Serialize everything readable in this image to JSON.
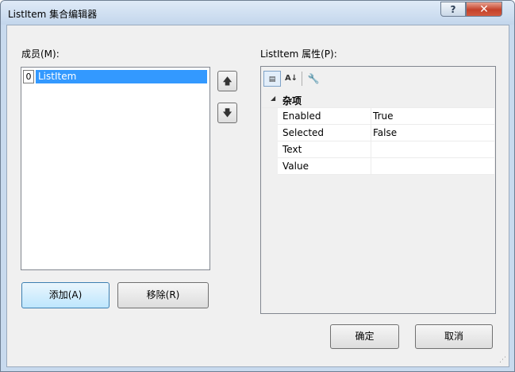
{
  "window": {
    "title": "ListItem 集合编辑器"
  },
  "titlebar": {
    "help_glyph": "?",
    "close_glyph": "✕"
  },
  "members": {
    "label": "成员(M):",
    "items": [
      {
        "index": "0",
        "name": "ListItem"
      }
    ]
  },
  "order_buttons": {
    "up_glyph": "🡅",
    "down_glyph": "🡇"
  },
  "buttons": {
    "add": "添加(A)",
    "remove": "移除(R)",
    "ok": "确定",
    "cancel": "取消"
  },
  "properties": {
    "label": "ListItem 属性(P):",
    "toolbar": {
      "categorized_glyph": "▤",
      "alphabetical_glyph": "A↓",
      "property_pages_glyph": "🔧"
    },
    "category": "杂项",
    "rows": [
      {
        "name": "Enabled",
        "value": "True"
      },
      {
        "name": "Selected",
        "value": "False"
      },
      {
        "name": "Text",
        "value": ""
      },
      {
        "name": "Value",
        "value": ""
      }
    ]
  }
}
